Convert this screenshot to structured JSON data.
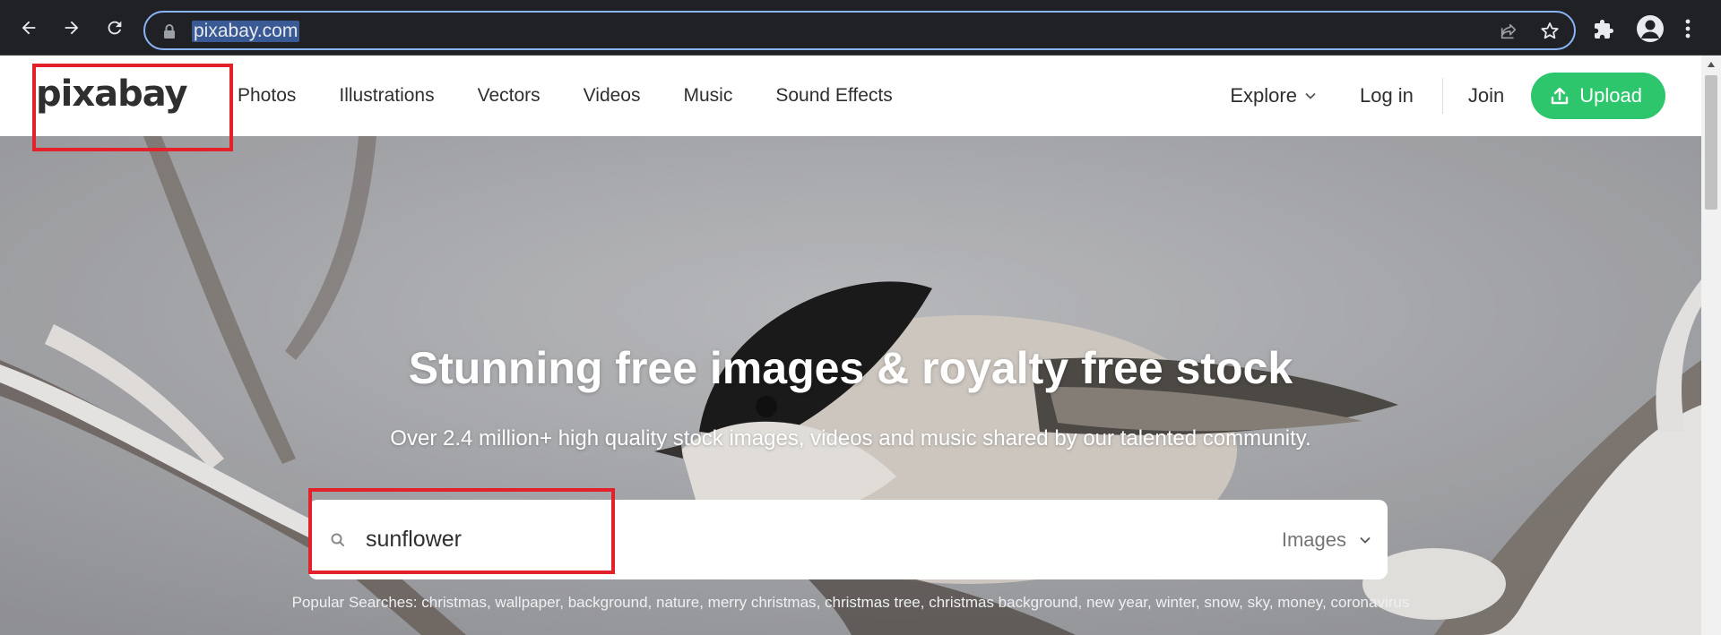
{
  "browser": {
    "url": "pixabay.com",
    "icons": [
      "back-arrow-icon",
      "forward-arrow-icon",
      "reload-icon",
      "lock-icon",
      "share-icon",
      "star-icon",
      "extensions-icon",
      "profile-icon",
      "menu-icon"
    ]
  },
  "header": {
    "logo_text": "pixabay",
    "nav": [
      "Photos",
      "Illustrations",
      "Vectors",
      "Videos",
      "Music",
      "Sound Effects"
    ],
    "explore_label": "Explore",
    "login_label": "Log in",
    "join_label": "Join",
    "upload_label": "Upload"
  },
  "hero": {
    "title": "Stunning free images & royalty free stock",
    "subtitle": "Over 2.4 million+ high quality stock images, videos and music shared by our talented community.",
    "search": {
      "value": "sunflower",
      "type_selected": "Images"
    },
    "popular_label": "Popular Searches:",
    "popular_searches": [
      "christmas",
      "wallpaper",
      "background",
      "nature",
      "merry christmas",
      "christmas tree",
      "christmas background",
      "new year",
      "winter",
      "snow",
      "sky",
      "money",
      "coronavirus"
    ]
  },
  "colors": {
    "accent_green": "#2ec66d",
    "annotation_red": "#e3212b",
    "chrome_dark": "#202124",
    "focus_blue": "#8ab4f8"
  }
}
